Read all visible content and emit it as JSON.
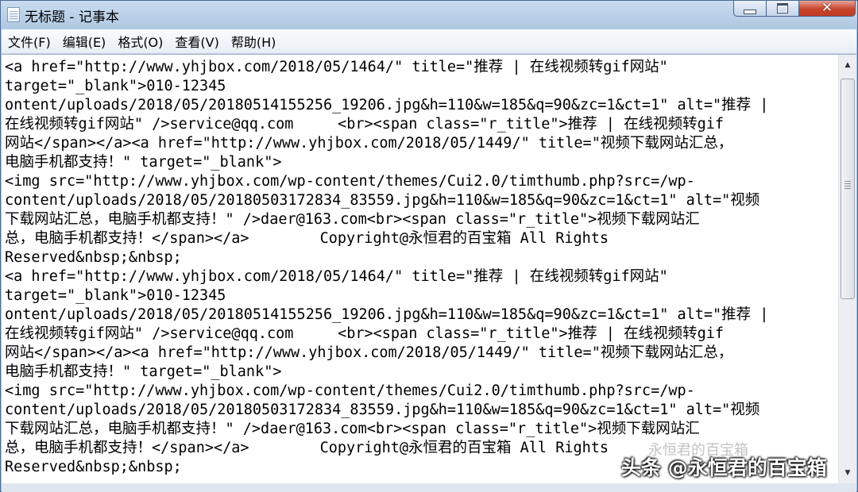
{
  "window": {
    "title": "无标题 - 记事本"
  },
  "menu": [
    "文件(F)",
    "编辑(E)",
    "格式(O)",
    "查看(V)",
    "帮助(H)"
  ],
  "controls": {
    "minimize": "",
    "maximize": "",
    "close": "✕"
  },
  "editor": {
    "lines": [
      "<a href=\"http://www.yhjbox.com/2018/05/1464/\" title=\"推荐 | 在线视频转gif网站\"",
      "target=\"_blank\">010-12345",
      "ontent/uploads/2018/05/20180514155256_19206.jpg&h=110&w=185&q=90&zc=1&ct=1\" alt=\"推荐 |",
      "在线视频转gif网站\" />service@qq.com     <br><span class=\"r_title\">推荐 | 在线视频转gif",
      "网站</span></a><a href=\"http://www.yhjbox.com/2018/05/1449/\" title=\"视频下载网站汇总，",
      "电脑手机都支持！\" target=\"_blank\">",
      "<img src=\"http://www.yhjbox.com/wp-content/themes/Cui2.0/timthumb.php?src=/wp-",
      "content/uploads/2018/05/20180503172834_83559.jpg&h=110&w=185&q=90&zc=1&ct=1\" alt=\"视频",
      "下载网站汇总，电脑手机都支持！\" />daer@163.com<br><span class=\"r_title\">视频下载网站汇",
      "总，电脑手机都支持！</span></a>        Copyright@永恒君的百宝箱 All Rights",
      "Reserved&nbsp;&nbsp;",
      "<a href=\"http://www.yhjbox.com/2018/05/1464/\" title=\"推荐 | 在线视频转gif网站\"",
      "target=\"_blank\">010-12345",
      "ontent/uploads/2018/05/20180514155256_19206.jpg&h=110&w=185&q=90&zc=1&ct=1\" alt=\"推荐 |",
      "在线视频转gif网站\" />service@qq.com     <br><span class=\"r_title\">推荐 | 在线视频转gif",
      "网站</span></a><a href=\"http://www.yhjbox.com/2018/05/1449/\" title=\"视频下载网站汇总，",
      "电脑手机都支持！\" target=\"_blank\">",
      "<img src=\"http://www.yhjbox.com/wp-content/themes/Cui2.0/timthumb.php?src=/wp-",
      "content/uploads/2018/05/20180503172834_83559.jpg&h=110&w=185&q=90&zc=1&ct=1\" alt=\"视频",
      "下载网站汇总，电脑手机都支持！\" />daer@163.com<br><span class=\"r_title\">视频下载网站汇",
      "总，电脑手机都支持！</span></a>        Copyright@永恒君的百宝箱 All Rights",
      "Reserved&nbsp;&nbsp;"
    ]
  },
  "scrollbar": {
    "up": "▲",
    "down": "▼"
  },
  "watermark": {
    "text": "头条 @永恒君的百宝箱",
    "faint": "永恒君的百宝箱"
  }
}
